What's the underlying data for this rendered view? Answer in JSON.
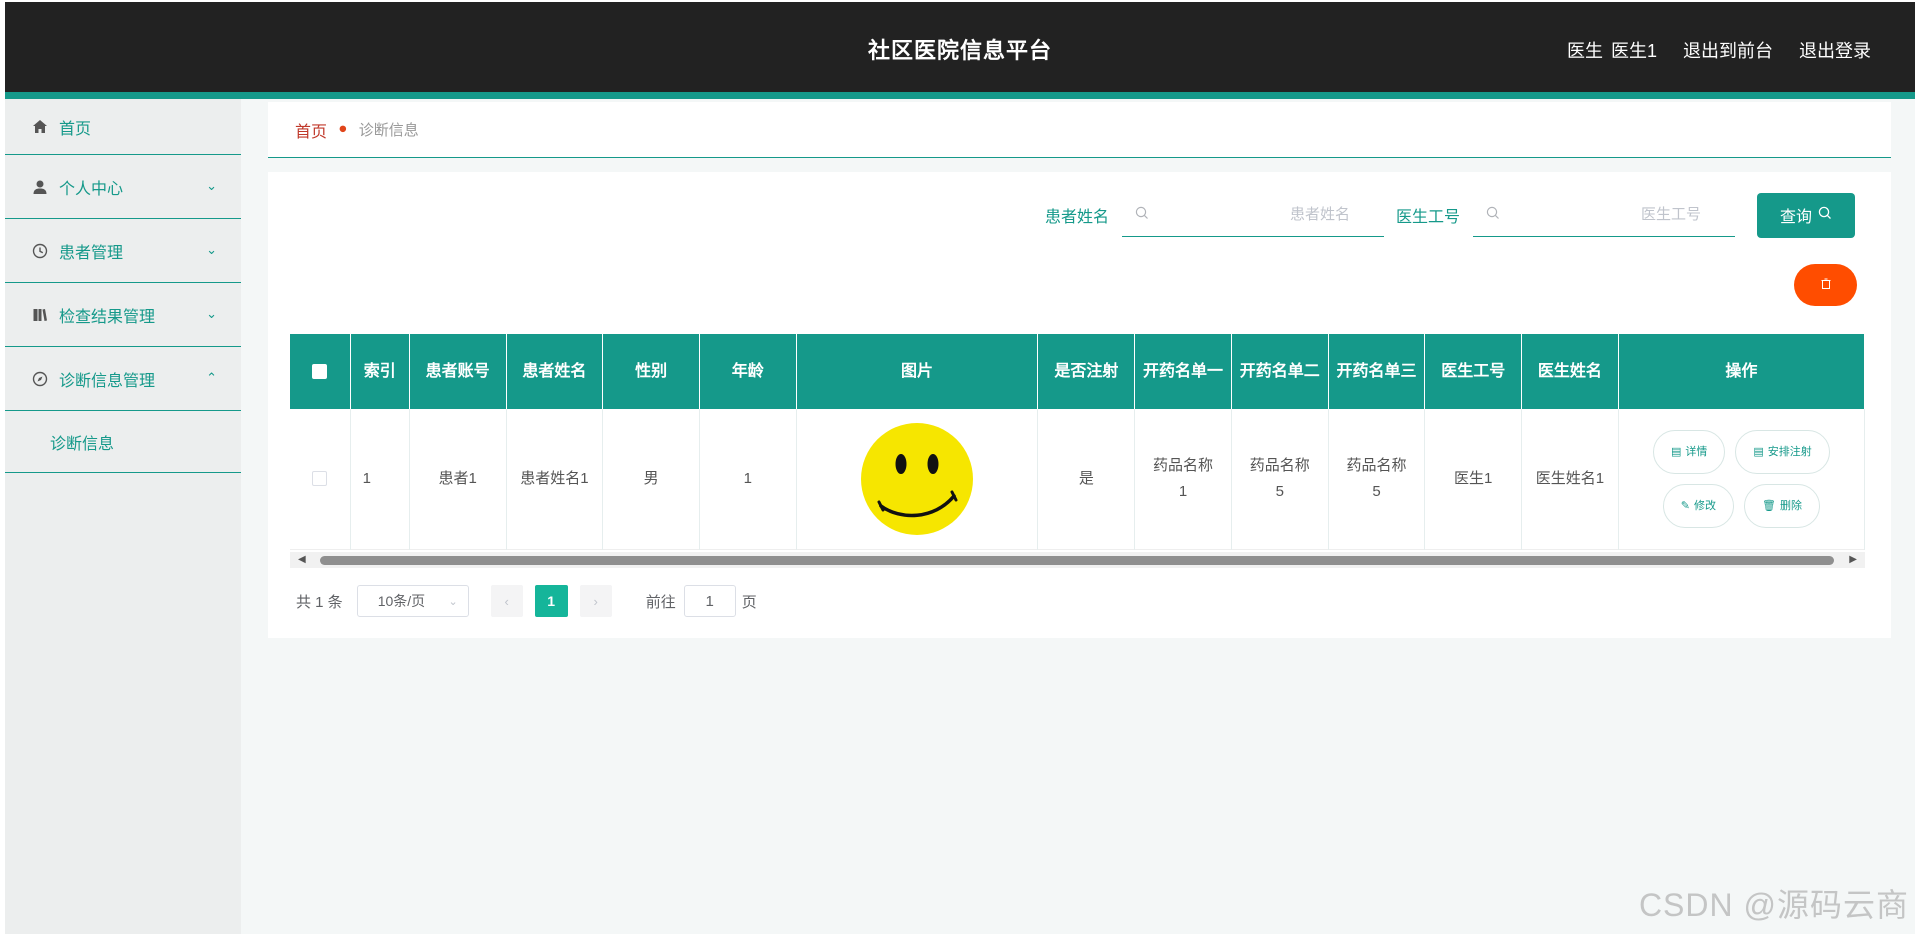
{
  "header": {
    "title": "社区医院信息平台",
    "user_role": "医生",
    "user_name": "医生1",
    "to_front": "退出到前台",
    "logout": "退出登录"
  },
  "sidebar": {
    "items": [
      {
        "label": "首页",
        "icon": "home-icon"
      },
      {
        "label": "个人中心",
        "icon": "user-icon"
      },
      {
        "label": "患者管理",
        "icon": "clock-icon"
      },
      {
        "label": "检查结果管理",
        "icon": "book-icon"
      },
      {
        "label": "诊断信息管理",
        "icon": "compass-icon"
      }
    ],
    "sub_items": [
      {
        "label": "诊断信息"
      }
    ]
  },
  "breadcrumb": {
    "home": "首页",
    "current": "诊断信息"
  },
  "search": {
    "patient_name_label": "患者姓名",
    "patient_name_placeholder": "患者姓名",
    "doctor_id_label": "医生工号",
    "doctor_id_placeholder": "医生工号",
    "query_button": "查询"
  },
  "table": {
    "headers": [
      "索引",
      "患者账号",
      "患者姓名",
      "性别",
      "年龄",
      "图片",
      "是否注射",
      "开药名单一",
      "开药名单二",
      "开药名单三",
      "医生工号",
      "医生姓名",
      "操作"
    ],
    "rows": [
      {
        "index": "1",
        "account": "患者1",
        "name": "患者姓名1",
        "gender": "男",
        "age": "1",
        "injected": "是",
        "drug1": "药品名称1",
        "drug2": "药品名称5",
        "drug3": "药品名称5",
        "doctor_id": "医生1",
        "doctor_name": "医生姓名1"
      }
    ],
    "actions": {
      "detail": "详情",
      "arrange": "安排注射",
      "edit": "修改",
      "delete": "删除"
    }
  },
  "pagination": {
    "total": "共 1 条",
    "page_size": "10条/页",
    "current_page": "1",
    "goto_label": "前往",
    "goto_value": "1",
    "page_suffix": "页"
  },
  "watermark": "CSDN @源码云商",
  "colors": {
    "accent": "#15998a",
    "topbar": "#222222",
    "danger": "#ff4d00",
    "breadcrumb_home": "#c0392b"
  }
}
